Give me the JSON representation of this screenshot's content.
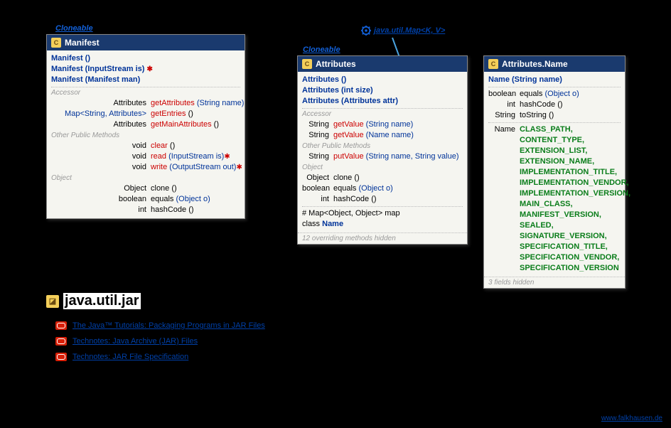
{
  "labels": {
    "cloneable": "Cloneable",
    "map_link_prefix": "java.util.",
    "map_link_name": "Map",
    "map_link_generics": "<K, V>"
  },
  "manifest": {
    "title": "Manifest",
    "ctors": [
      {
        "sig": "Manifest ()"
      },
      {
        "sig": "Manifest (InputStream is)",
        "throws": true
      },
      {
        "sig": "Manifest (Manifest man)"
      }
    ],
    "accessor_label": "Accessor",
    "accessors": [
      {
        "ret": "Attributes",
        "m": "getAttributes",
        "p": "(String name)"
      },
      {
        "ret": "Map<String, Attributes>",
        "m": "getEntries",
        "p": "()"
      },
      {
        "ret": "Attributes",
        "m": "getMainAttributes",
        "p": "()"
      }
    ],
    "other_label": "Other Public Methods",
    "others": [
      {
        "ret": "void",
        "m": "clear",
        "p": "()"
      },
      {
        "ret": "void",
        "m": "read",
        "p": "(InputStream is)",
        "throws": true
      },
      {
        "ret": "void",
        "m": "write",
        "p": "(OutputStream out)",
        "throws": true
      }
    ],
    "object_label": "Object",
    "objects": [
      {
        "ret": "Object",
        "m": "clone",
        "p": "()",
        "plain": true
      },
      {
        "ret": "boolean",
        "m": "equals",
        "p": "(Object o)",
        "plain": true
      },
      {
        "ret": "int",
        "m": "hashCode",
        "p": "()",
        "plain": true
      }
    ]
  },
  "attributes": {
    "title": "Attributes",
    "ctors": [
      {
        "sig": "Attributes ()"
      },
      {
        "sig": "Attributes (int size)"
      },
      {
        "sig": "Attributes (Attributes attr)"
      }
    ],
    "accessor_label": "Accessor",
    "accessors": [
      {
        "ret": "String",
        "m": "getValue",
        "p": "(String name)"
      },
      {
        "ret": "String",
        "m": "getValue",
        "p": "(Name name)"
      }
    ],
    "other_label": "Other Public Methods",
    "others": [
      {
        "ret": "String",
        "m": "putValue",
        "p": "(String name, String value)"
      }
    ],
    "object_label": "Object",
    "objects": [
      {
        "ret": "Object",
        "m": "clone",
        "p": "()",
        "plain": true
      },
      {
        "ret": "boolean",
        "m": "equals",
        "p": "(Object o)",
        "plain": true
      },
      {
        "ret": "int",
        "m": "hashCode",
        "p": "()",
        "plain": true
      }
    ],
    "field": {
      "prefix": "# Map<Object, Object>",
      "name": "map"
    },
    "inner": {
      "prefix": "class",
      "name": "Name"
    },
    "hidden": "12 overriding methods hidden"
  },
  "attr_name": {
    "title": "Attributes.Name",
    "ctor": "Name (String name)",
    "methods": [
      {
        "ret": "boolean",
        "m": "equals",
        "p": "(Object o)"
      },
      {
        "ret": "int",
        "m": "hashCode",
        "p": "()"
      },
      {
        "ret": "String",
        "m": "toString",
        "p": "()"
      }
    ],
    "const_ret": "Name",
    "constants": [
      "CLASS_PATH,",
      "CONTENT_TYPE,",
      "EXTENSION_LIST,",
      "EXTENSION_NAME,",
      "IMPLEMENTATION_TITLE,",
      "IMPLEMENTATION_VENDOR,",
      "IMPLEMENTATION_VERSION,",
      "MAIN_CLASS,",
      "MANIFEST_VERSION,",
      "SEALED,",
      "SIGNATURE_VERSION,",
      "SPECIFICATION_TITLE,",
      "SPECIFICATION_VENDOR,",
      "SPECIFICATION_VERSION"
    ],
    "hidden": "3 fields hidden"
  },
  "package": "java.util.jar",
  "links": [
    "The Java™ Tutorials: Packaging Programs in JAR Files",
    "Technotes: Java Archive (JAR) Files",
    "Technotes: JAR File Specification"
  ],
  "footer": "www.falkhausen.de"
}
